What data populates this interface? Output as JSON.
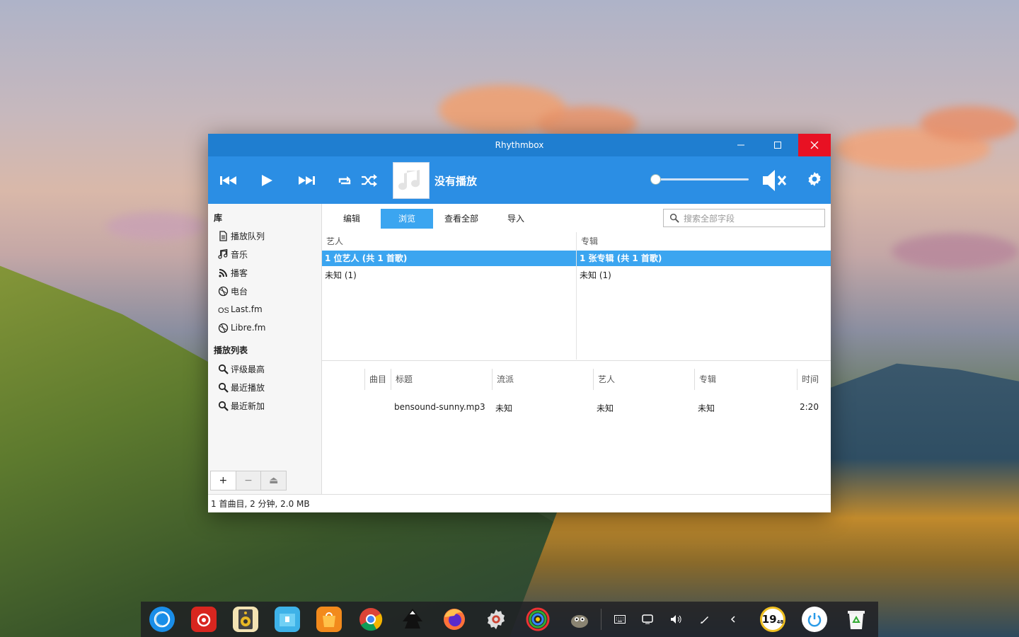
{
  "window": {
    "title": "Rhythmbox"
  },
  "player": {
    "now_playing": "没有播放",
    "volume_fraction": 0.0
  },
  "sidebar": {
    "library_heading": "库",
    "library_items": [
      {
        "label": "播放队列",
        "icon": "queue-icon"
      },
      {
        "label": "音乐",
        "icon": "music-icon"
      },
      {
        "label": "播客",
        "icon": "podcast-icon"
      },
      {
        "label": "电台",
        "icon": "radio-icon"
      },
      {
        "label": "Last.fm",
        "icon": "lastfm-icon"
      },
      {
        "label": "Libre.fm",
        "icon": "librefm-icon"
      }
    ],
    "playlist_heading": "播放列表",
    "playlist_items": [
      {
        "label": "评级最高",
        "icon": "search-icon"
      },
      {
        "label": "最近播放",
        "icon": "search-icon"
      },
      {
        "label": "最近新加",
        "icon": "search-icon"
      }
    ],
    "buttons": {
      "add": "+",
      "remove": "−",
      "eject": "⏏"
    }
  },
  "tabs": [
    {
      "label": "编辑",
      "active": false
    },
    {
      "label": "浏览",
      "active": true
    },
    {
      "label": "查看全部",
      "active": false
    },
    {
      "label": "导入",
      "active": false
    }
  ],
  "search": {
    "placeholder": "搜索全部字段"
  },
  "browser": {
    "artist_header": "艺人",
    "album_header": "专辑",
    "artist_all": "1 位艺人 (共 1 首歌)",
    "album_all": "1 张专辑 (共 1 首歌)",
    "artist_rows": [
      "未知 (1)"
    ],
    "album_rows": [
      "未知 (1)"
    ]
  },
  "tracks": {
    "columns": [
      "曲目",
      "标题",
      "流派",
      "艺人",
      "专辑",
      "时间"
    ],
    "rows": [
      {
        "track": "",
        "title": "bensound-sunny.mp3",
        "genre": "未知",
        "artist": "未知",
        "album": "未知",
        "time": "2:20"
      }
    ]
  },
  "status_bar": "1 首曲目, 2 分钟, 2.0 MB",
  "dock": {
    "apps": [
      "deepin-launcher-icon",
      "netease-music-icon",
      "deepin-music-icon",
      "file-manager-icon",
      "app-store-icon",
      "chrome-icon",
      "inkscape-icon",
      "firefox-icon",
      "settings-icon",
      "color-picker-icon",
      "gimp-icon"
    ],
    "clock": "19",
    "clock_minutes": "48"
  },
  "colors": {
    "accent": "#2b8ee4",
    "titlebar": "#1f7ed0",
    "selection": "#3ba5f0",
    "close": "#e81123"
  }
}
